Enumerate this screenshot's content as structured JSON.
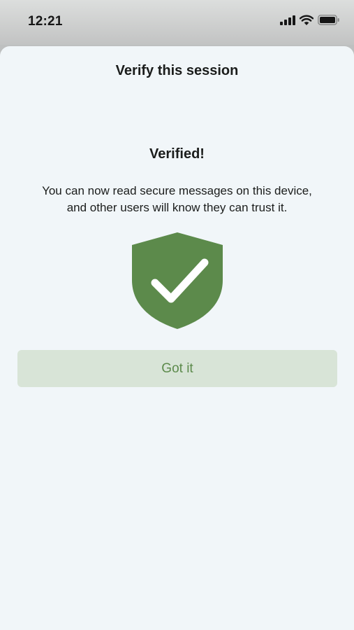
{
  "status_bar": {
    "time": "12:21",
    "icons": [
      "cellular-signal-icon",
      "wifi-icon",
      "battery-icon"
    ]
  },
  "sheet": {
    "title": "Verify this session",
    "heading": "Verified!",
    "message_line1": "You can now read secure messages on this device,",
    "message_line2": "and other users will know they can trust it.",
    "shield_icon": "shield-check-icon",
    "button_label": "Got it"
  },
  "colors": {
    "accent": "#5c8a4b",
    "button_background": "#d8e4d7",
    "sheet_background": "#f1f6f9"
  }
}
